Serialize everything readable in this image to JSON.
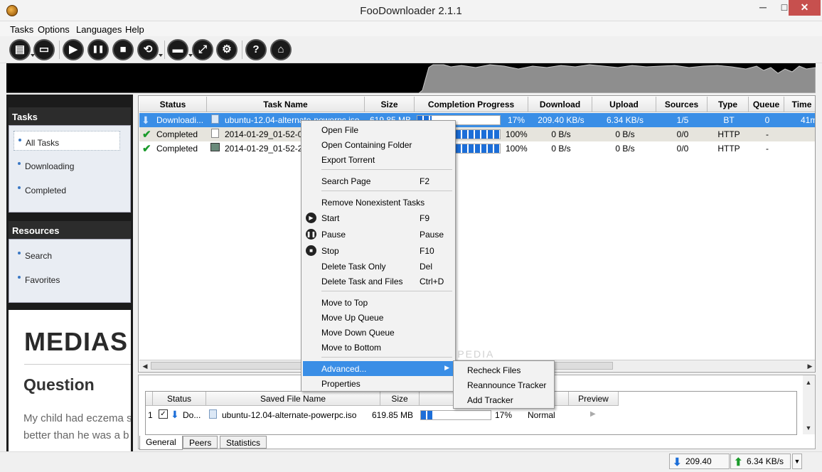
{
  "window": {
    "title": "FooDownloader 2.1.1",
    "minimize": "─",
    "maximize": "□",
    "close": "✕"
  },
  "menu": [
    "Tasks",
    "Options",
    "Languages",
    "Help"
  ],
  "toolbar": [
    {
      "name": "new-task",
      "glyph": "▤"
    },
    {
      "name": "open",
      "glyph": "▭"
    },
    {
      "name": "start",
      "glyph": "▶"
    },
    {
      "name": "pause",
      "glyph": "❚❚"
    },
    {
      "name": "stop",
      "glyph": "■"
    },
    {
      "name": "remove",
      "glyph": "⟲"
    },
    {
      "name": "folder",
      "glyph": "▬"
    },
    {
      "name": "fullscreen",
      "glyph": "⤢"
    },
    {
      "name": "settings",
      "glyph": "⚙"
    },
    {
      "name": "help",
      "glyph": "?"
    },
    {
      "name": "home",
      "glyph": "⌂"
    }
  ],
  "sidebar": {
    "tasks_title": "Tasks",
    "tasks": [
      "All Tasks",
      "Downloading",
      "Completed"
    ],
    "resources_title": "Resources",
    "resources": [
      "Search",
      "Favorites"
    ]
  },
  "ad": {
    "logo": "MEDIAS",
    "question": "Question",
    "line1": "My child had eczema s",
    "line2": "better than he was a b"
  },
  "tasklist": {
    "columns": [
      "Status",
      "Task Name",
      "Size",
      "Completion Progress",
      "Download",
      "Upload",
      "Sources",
      "Type",
      "Queue",
      "Time"
    ],
    "rows": [
      {
        "status": "Downloadi...",
        "name": "ubuntu-12.04-alternate-powerpc.iso",
        "size": "619.85 MB",
        "progress": "17%",
        "progress_value": 0.17,
        "download": "209.40 KB/s",
        "upload": "6.34 KB/s",
        "sources": "1/5",
        "type": "BT",
        "queue": "0",
        "time": "41m"
      },
      {
        "status": "Completed",
        "name": "2014-01-29_01-52-04",
        "size": "",
        "progress": "100%",
        "progress_value": 1.0,
        "download": "0 B/s",
        "upload": "0 B/s",
        "sources": "0/0",
        "type": "HTTP",
        "queue": "-",
        "time": ""
      },
      {
        "status": "Completed",
        "name": "2014-01-29_01-52-29",
        "size": "",
        "progress": "100%",
        "progress_value": 1.0,
        "download": "0 B/s",
        "upload": "0 B/s",
        "sources": "0/0",
        "type": "HTTP",
        "queue": "-",
        "time": ""
      }
    ]
  },
  "context_menu": {
    "open_file": "Open File",
    "open_folder": "Open Containing Folder",
    "export_torrent": "Export Torrent",
    "search_page": "Search Page",
    "search_page_key": "F2",
    "remove_nonexistent": "Remove Nonexistent Tasks",
    "start": "Start",
    "start_key": "F9",
    "pause": "Pause",
    "pause_key": "Pause",
    "stop": "Stop",
    "stop_key": "F10",
    "delete_task": "Delete Task Only",
    "delete_task_key": "Del",
    "delete_files": "Delete Task and Files",
    "delete_files_key": "Ctrl+D",
    "move_top": "Move to Top",
    "move_up": "Move Up Queue",
    "move_down": "Move Down Queue",
    "move_bottom": "Move to Bottom",
    "advanced": "Advanced...",
    "properties": "Properties"
  },
  "submenu": [
    "Recheck Files",
    "Reannounce Tracker",
    "Add Tracker"
  ],
  "detail": {
    "columns": [
      "Status",
      "Saved File Name",
      "Size",
      "",
      "y",
      "Preview"
    ],
    "row": {
      "index": "1",
      "status": "Do...",
      "name": "ubuntu-12.04-alternate-powerpc.iso",
      "size": "619.85 MB",
      "progress": "17%",
      "progress_value": 0.17,
      "priority": "Normal"
    }
  },
  "tabs": [
    "General",
    "Peers",
    "Statistics"
  ],
  "statusbar": {
    "download": "209.40 KB/s",
    "upload": "6.34 KB/s"
  },
  "watermark": "SOFTPEDIA",
  "colors": {
    "selection": "#3a8ee6",
    "progress": "#1c6ed8",
    "close": "#c7504e",
    "check": "#1a9a2a"
  }
}
